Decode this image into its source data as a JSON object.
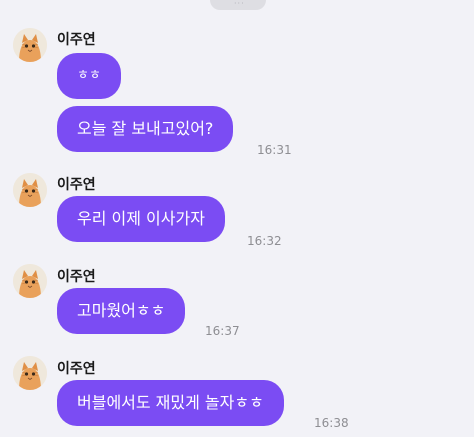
{
  "top_indicator": "···",
  "messages": [
    {
      "sender": "이주연",
      "bubbles": [
        "ㅎㅎ",
        "오늘 잘 보내고있어?"
      ],
      "time": "16:31"
    },
    {
      "sender": "이주연",
      "bubbles": [
        "우리 이제 이사가자"
      ],
      "time": "16:32"
    },
    {
      "sender": "이주연",
      "bubbles": [
        "고마웠어ㅎㅎ"
      ],
      "time": "16:37"
    },
    {
      "sender": "이주연",
      "bubbles": [
        "버블에서도 재밌게 놀자ㅎㅎ"
      ],
      "time": "16:38"
    }
  ],
  "colors": {
    "background": "#f2f2f7",
    "bubble": "#7b4cf3",
    "bubble_text": "#ffffff",
    "time": "#8e8e93"
  }
}
